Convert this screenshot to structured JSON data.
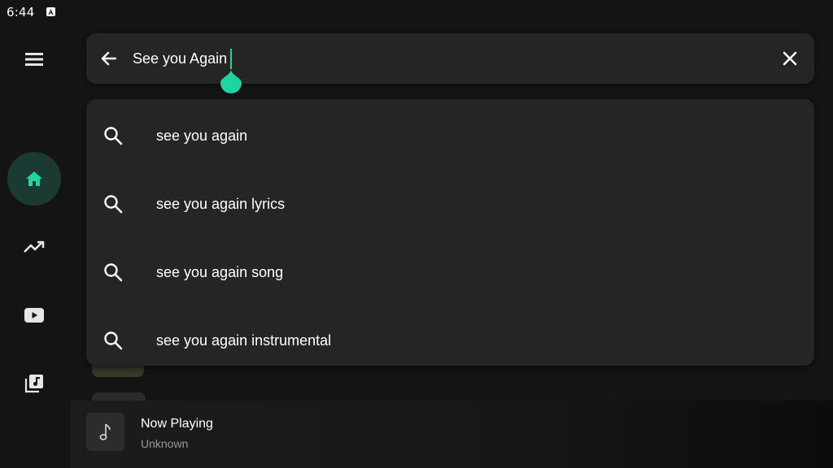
{
  "status_bar": {
    "time": "6:44",
    "notification_icon": "a-square-icon"
  },
  "colors": {
    "accent": "#1ed4a0",
    "active_nav_bg": "#1b3a31",
    "surface": "#252525",
    "background": "#141414"
  },
  "nav": {
    "menu_icon": "menu-icon",
    "items": [
      {
        "id": "home",
        "icon": "home-icon",
        "active": true
      },
      {
        "id": "trending",
        "icon": "trending-up-icon",
        "active": false
      },
      {
        "id": "youtube",
        "icon": "youtube-icon",
        "active": false
      },
      {
        "id": "library",
        "icon": "library-music-icon",
        "active": false
      }
    ]
  },
  "search": {
    "value": "See you Again",
    "back_icon": "arrow-back-icon",
    "clear_icon": "close-icon"
  },
  "suggestions": [
    {
      "text": "see you again",
      "icon": "search-icon"
    },
    {
      "text": "see you again lyrics",
      "icon": "search-icon"
    },
    {
      "text": "see you again song",
      "icon": "search-icon"
    },
    {
      "text": "see you again instrumental",
      "icon": "search-icon"
    }
  ],
  "now_playing": {
    "title": "Now Playing",
    "subtitle": "Unknown",
    "art_icon": "music-note-icon"
  }
}
